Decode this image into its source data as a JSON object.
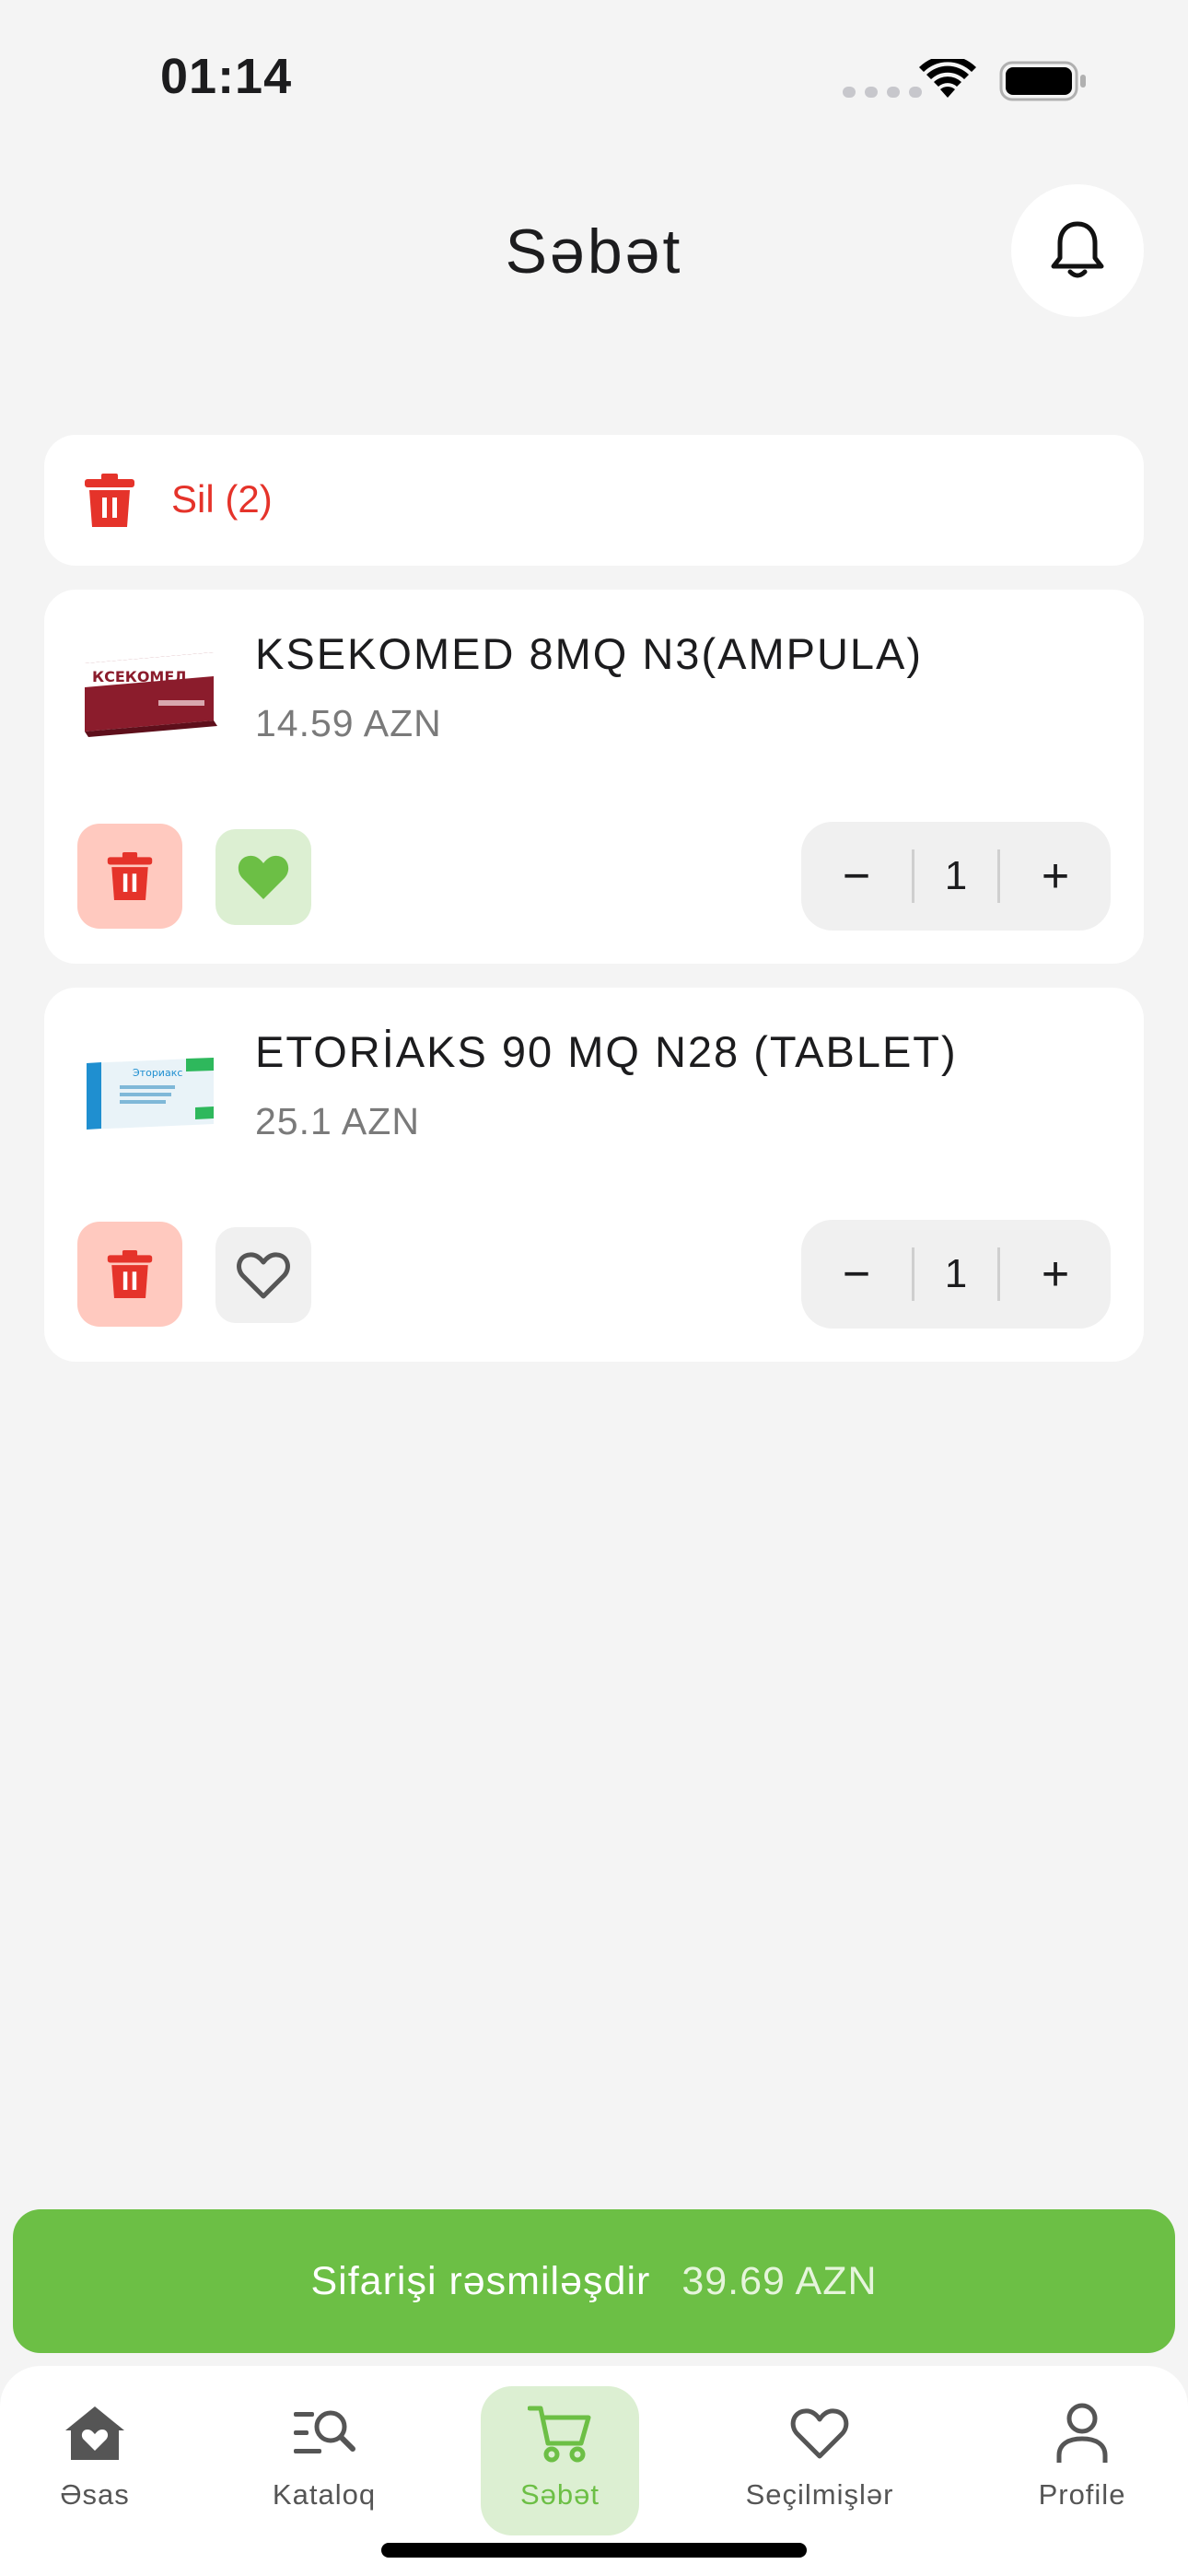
{
  "status_bar": {
    "time": "01:14"
  },
  "header": {
    "title": "Səbət"
  },
  "delete_all": {
    "label": "Sil (2)"
  },
  "items": [
    {
      "name": "KSEKOMED 8MQ N3(AMPULA)",
      "price": "14.59 AZN",
      "quantity": "1",
      "favorite": true,
      "thumb_label": "КСЕКОМЕД"
    },
    {
      "name": "ETORİAKS 90 MQ N28 (TABLET)",
      "price": "25.1 AZN",
      "quantity": "1",
      "favorite": false,
      "thumb_label": "Эториакс"
    }
  ],
  "stepper": {
    "minus": "−",
    "plus": "+"
  },
  "checkout": {
    "label": "Sifarişi rəsmiləşdir",
    "total": "39.69 AZN"
  },
  "tabs": [
    {
      "label": "Əsas",
      "icon": "home-heart-icon"
    },
    {
      "label": "Kataloq",
      "icon": "catalog-search-icon"
    },
    {
      "label": "Səbət",
      "icon": "cart-icon",
      "active": true
    },
    {
      "label": "Seçilmişlər",
      "icon": "heart-outline-icon"
    },
    {
      "label": "Profile",
      "icon": "user-icon"
    }
  ],
  "colors": {
    "accent": "#6cbf45",
    "danger": "#e5332a",
    "danger_bg": "#ffc9bf",
    "fav_bg": "#dcefd2"
  }
}
